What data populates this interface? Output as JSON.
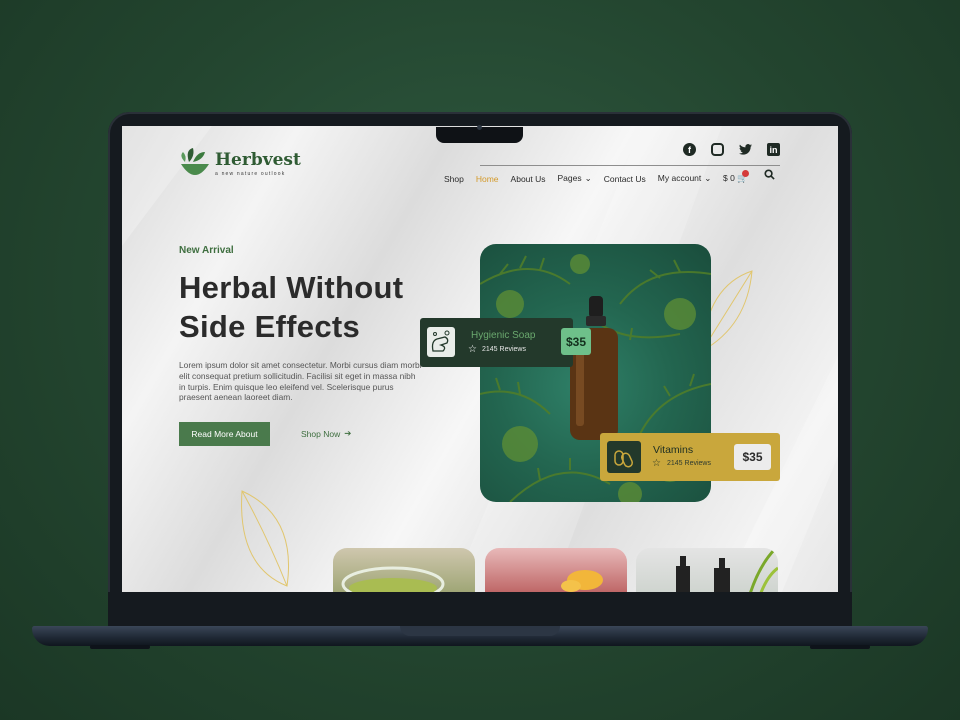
{
  "brand": {
    "name": "Herbvest",
    "tagline": "a new nature outlook"
  },
  "socials": [
    {
      "name": "facebook",
      "glyph": "f"
    },
    {
      "name": "instagram",
      "glyph": ""
    },
    {
      "name": "twitter",
      "glyph": "🐦"
    },
    {
      "name": "linkedin",
      "glyph": "in"
    }
  ],
  "nav": {
    "items": [
      "Shop",
      "Home",
      "About Us",
      "Pages",
      "Contact Us",
      "My account"
    ],
    "active": "Home",
    "cart": "$ 0"
  },
  "hero": {
    "eyebrow": "New Arrival",
    "title_line1": "Herbal Without",
    "title_line2": "Side Effects",
    "paragraph": "Lorem ipsum dolor sit amet consectetur. Morbi cursus diam morbi elit consequat pretium sollicitudin. Facilisi sit eget in massa nibh in turpis. Enim quisque leo eleifend vel. Scelerisque purus praesent aenean laoreet diam.",
    "primary_button": "Read More About",
    "secondary_link": "Shop Now"
  },
  "cards": [
    {
      "title": "Hygienic Soap",
      "reviews": "2145 Reviews",
      "price": "$35"
    },
    {
      "title": "Vitamins",
      "reviews": "2145 Reviews",
      "price": "$35"
    }
  ],
  "colors": {
    "brand_green": "#4a7a4c",
    "accent_gold": "#c9a73c",
    "dark_green": "#23392b",
    "active_nav": "#d49a2a"
  }
}
